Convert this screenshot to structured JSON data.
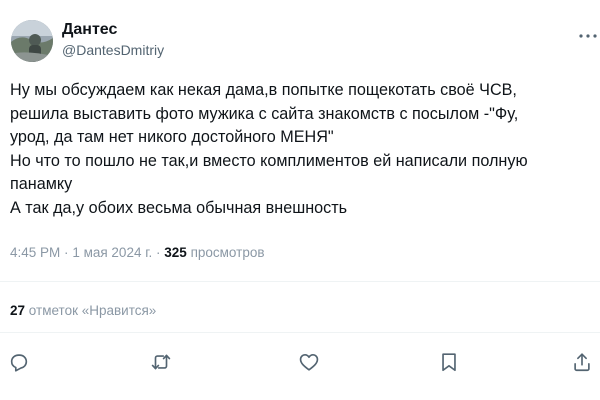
{
  "author": {
    "name": "Дантес",
    "handle": "@DantesDmitriy"
  },
  "tweet": {
    "lines": [
      "Ну мы обсуждаем как некая дама,в попытке пощекотать своё ЧСВ,",
      "решила выставить фото мужика с сайта знакомств с посылом -\"Фу,",
      "урод, да там нет никого достойного МЕНЯ\"",
      "Но что то пошло не так,и вместо комплиментов ей написали полную",
      "панамку",
      "А так да,у обоих весьма обычная внешность"
    ]
  },
  "meta": {
    "time": "4:45 PM",
    "separator": "·",
    "date": "1 мая 2024 г.",
    "views_count": "325",
    "views_label": "просмотров"
  },
  "likes": {
    "count": "27",
    "label": "отметок «Нравится»"
  },
  "actions": [
    {
      "icon": "reply-icon"
    },
    {
      "icon": "retweet-icon"
    },
    {
      "icon": "like-icon"
    },
    {
      "icon": "bookmark-icon"
    },
    {
      "icon": "share-icon"
    }
  ],
  "colors": {
    "text": "#0f1419",
    "secondary": "#536471",
    "meta": "#8b98a5",
    "divider": "#eff3f4",
    "icon": "#536471"
  }
}
